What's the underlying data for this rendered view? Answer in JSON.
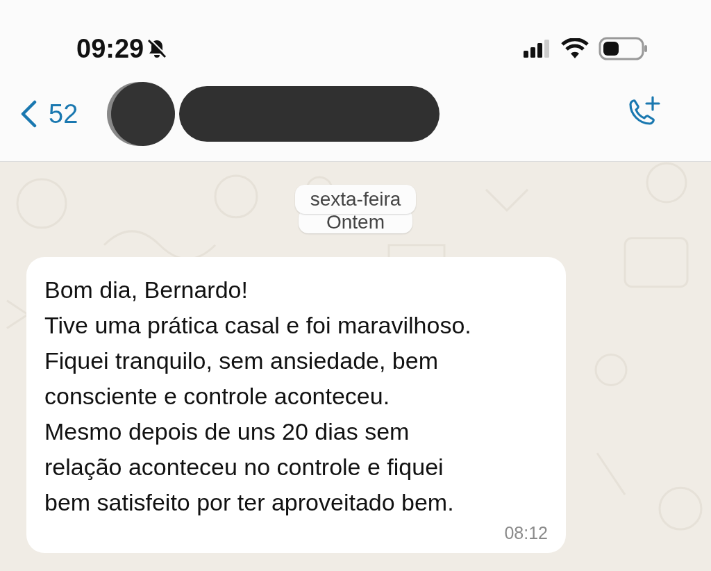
{
  "status_bar": {
    "time": "09:29",
    "muted": true
  },
  "header": {
    "back_count": "52"
  },
  "date_chips": [
    {
      "label": "sexta-feira"
    },
    {
      "label": "Ontem"
    }
  ],
  "message": {
    "lines": [
      "Bom dia, Bernardo!",
      "Tive uma prática casal e foi maravilhoso.",
      "Fiquei tranquilo, sem ansiedade, bem",
      "consciente e controle aconteceu.",
      "Mesmo depois de uns 20 dias sem",
      "relação aconteceu no controle e fiquei",
      "bem satisfeito por ter aproveitado bem."
    ],
    "time": "08:12"
  }
}
